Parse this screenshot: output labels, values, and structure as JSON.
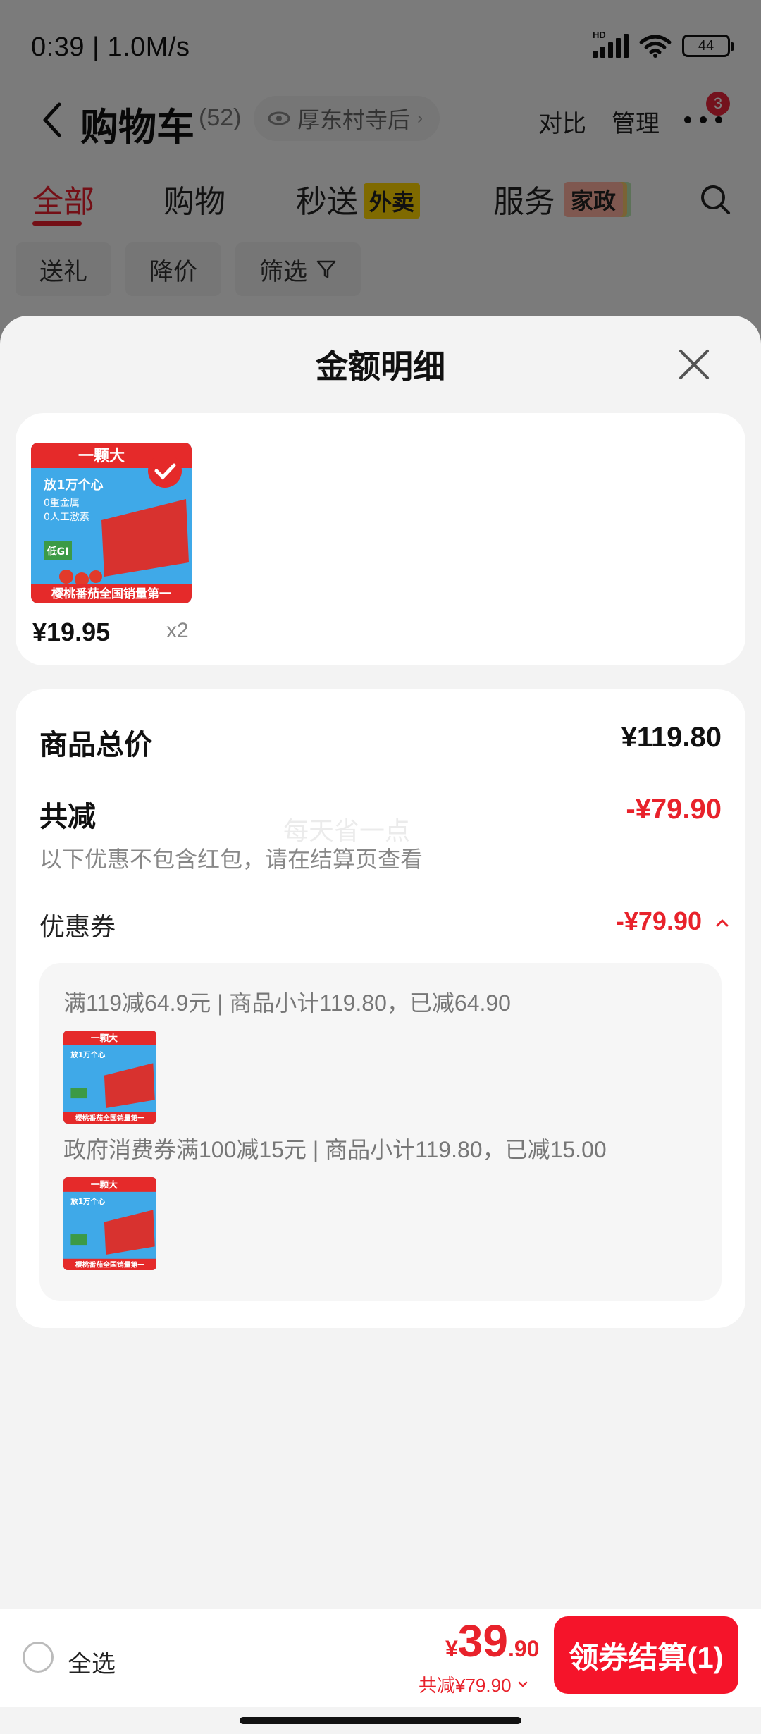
{
  "status_bar": {
    "time": "0:39 | 1.0M/s",
    "battery": "44",
    "network": "HD"
  },
  "nav": {
    "title": "购物车",
    "count": "(52)",
    "location": "厚东村寺后",
    "compare": "对比",
    "manage": "管理",
    "badge": "3"
  },
  "tabs": [
    {
      "label": "全部"
    },
    {
      "label": "购物"
    },
    {
      "label": "秒送",
      "tag": "外卖"
    },
    {
      "label": "服务",
      "tag": "家政"
    }
  ],
  "filters": [
    "送礼",
    "降价",
    "筛选"
  ],
  "sheet": {
    "title": "金额明细",
    "product": {
      "image_text": "一颗大",
      "image_line1": "放1万个心",
      "image_line2": "0重金属",
      "image_line3": "0人工激素",
      "image_gi": "低GI",
      "image_banner": "樱桃番茄全国销量第一",
      "price": "¥19.95",
      "qty": "x2"
    },
    "detail": {
      "total_label": "商品总价",
      "total_value": "¥119.80",
      "discount_label": "共减",
      "discount_value": "-¥79.90",
      "note": "以下优惠不包含红包，请在结算页查看",
      "watermark": "每天省一点",
      "coupon_label": "优惠券",
      "coupon_value": "-¥79.90",
      "coupons": [
        {
          "text": "满119减64.9元 | 商品小计119.80，已减64.90"
        },
        {
          "text": "政府消费券满100减15元 | 商品小计119.80，已减15.00"
        }
      ]
    }
  },
  "bottom": {
    "select_all": "全选",
    "currency": "¥",
    "price_int": "39",
    "price_dec": ".90",
    "discount_sum": "共减¥79.90",
    "checkout": "领券结算(1)"
  },
  "colors": {
    "accent": "#e8222b",
    "button": "#f5142a"
  }
}
